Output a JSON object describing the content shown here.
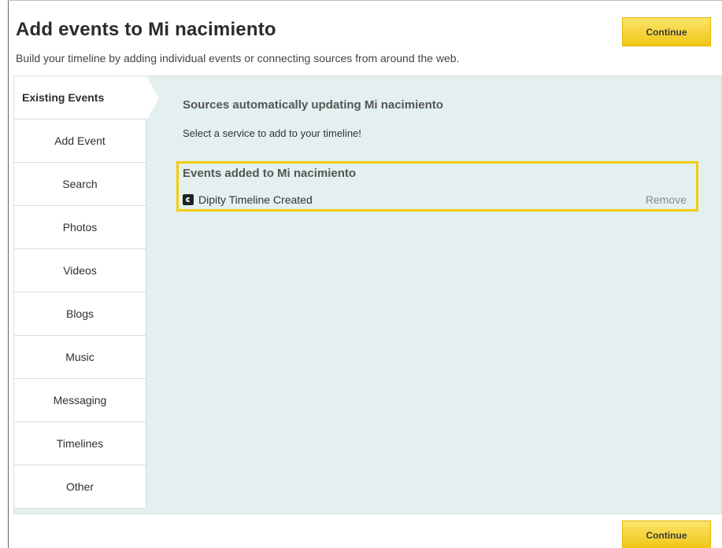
{
  "header": {
    "title": "Add events to Mi nacimiento",
    "subtitle": "Build your timeline by adding individual events or connecting sources from around the web.",
    "continue_label": "Continue"
  },
  "tabs": [
    {
      "label": "Existing Events",
      "active": true
    },
    {
      "label": "Add Event"
    },
    {
      "label": "Search"
    },
    {
      "label": "Photos"
    },
    {
      "label": "Videos"
    },
    {
      "label": "Blogs"
    },
    {
      "label": "Music"
    },
    {
      "label": "Messaging"
    },
    {
      "label": "Timelines"
    },
    {
      "label": "Other"
    }
  ],
  "sources": {
    "heading": "Sources automatically updating Mi nacimiento",
    "help": "Select a service to add to your timeline!"
  },
  "events": {
    "heading": "Events added to Mi nacimiento",
    "items": [
      {
        "icon": "dipity-icon",
        "title": "Dipity Timeline Created",
        "action": "Remove"
      }
    ]
  },
  "footer": {
    "continue_label": "Continue"
  },
  "colors": {
    "accent_yellow": "#f2cc0c",
    "panel_bg": "#e3f0ef"
  }
}
